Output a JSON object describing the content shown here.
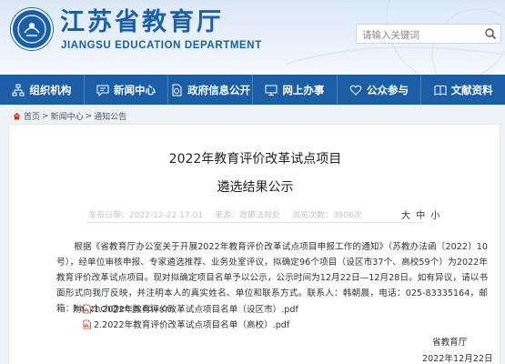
{
  "header": {
    "site_title": "江苏省教育厅",
    "site_subtitle": "JIANGSU EDUCATION DEPARTMENT",
    "search_placeholder": "请输入关键词",
    "colors": {
      "brand": "#1a5fa8",
      "nav": "#1c5ea6"
    }
  },
  "nav": {
    "items": [
      {
        "label": "组织机构",
        "icon": "org-chart-icon"
      },
      {
        "label": "新闻中心",
        "icon": "chat-bubble-icon"
      },
      {
        "label": "政府信息公开",
        "icon": "document-icon"
      },
      {
        "label": "网上办事",
        "icon": "monitor-icon"
      },
      {
        "label": "公众参与",
        "icon": "heart-hand-icon"
      },
      {
        "label": "文献资料",
        "icon": "book-icon"
      }
    ]
  },
  "breadcrumb": {
    "home": "首页",
    "section": "新闻中心",
    "current": "通知公告",
    "separator": ">"
  },
  "article": {
    "title_line1": "2022年教育评价改革试点项目",
    "title_line2": "遴选结果公示",
    "meta": {
      "date": "发布日期：2022-12-22 17:01",
      "source": "来源：政策法规处",
      "views": "浏览次数：3906次"
    },
    "font_sizes": [
      "大",
      "中",
      "小"
    ],
    "body": "根据《省教育厅办公室关于开展2022年教育评价改革试点项目申报工作的通知》（苏教办法函〔2022〕10号），经单位审核申报、专家遴选推荐、业务处室评议，拟确定96个项目（设区市37个、高校59个）为2022年教育评价改革试点项目。现对拟确定项目名单予以公示，公示时间为12月22日—12月28日。如有异议，请以书面形式向我厅反映，并注明本人的真实姓名、单位和联系方式。联系人：韩朝晨，电话：025-83335164，邮箱：hanzhch@ec.js.edu.cn。",
    "attachments_label": "附件：",
    "attachments": [
      "1.2022年教育评价改革试点项目名单（设区市）.pdf",
      "2.2022年教育评价改革试点项目名单（高校）.pdf"
    ],
    "signature": "省教育厅",
    "sign_date": "2022年12月22日"
  }
}
